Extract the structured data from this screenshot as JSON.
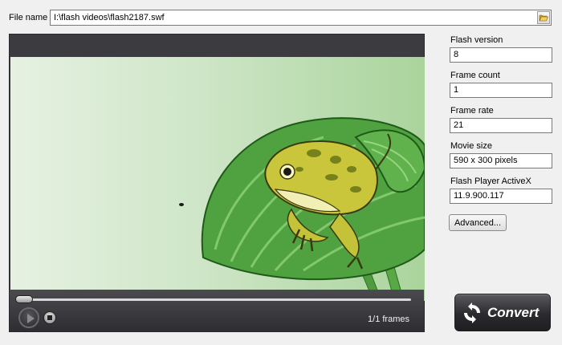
{
  "file": {
    "label": "File name",
    "value": "I:\\flash videos\\flash2187.swf",
    "browse_icon": "folder-open-icon"
  },
  "player": {
    "frames_label": "1/1 frames",
    "progress": 0,
    "play_icon": "play-icon",
    "stop_icon": "stop-icon"
  },
  "properties": [
    {
      "label": "Flash version",
      "value": "8"
    },
    {
      "label": "Frame count",
      "value": "1"
    },
    {
      "label": "Frame rate",
      "value": "21"
    },
    {
      "label": "Movie size",
      "value": "590 x 300 pixels"
    },
    {
      "label": "Flash Player ActiveX",
      "value": "11.9.900.117"
    }
  ],
  "buttons": {
    "advanced_label": "Advanced...",
    "convert_label": "Convert",
    "convert_icon": "convert-arrows-icon"
  },
  "colors": {
    "accent_dark": "#2b2b2f",
    "leaf_green": "#3f9a3a",
    "frog_yellow": "#c8c43a"
  }
}
